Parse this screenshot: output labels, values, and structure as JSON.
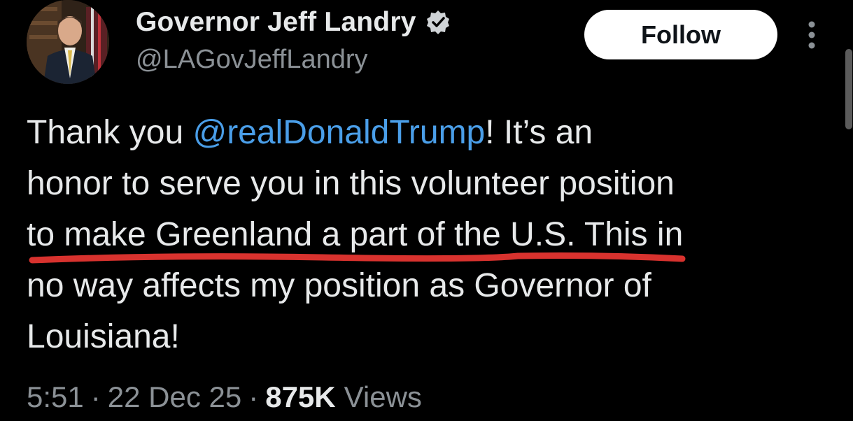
{
  "author": {
    "display_name": "Governor Jeff Landry",
    "handle": "@LAGovJeffLandry",
    "verified_icon": "verified-badge-icon",
    "avatar_icon": "profile-photo"
  },
  "actions": {
    "follow_label": "Follow",
    "more_icon": "more-vertical-icon"
  },
  "tweet": {
    "line1_pre": "Thank you ",
    "mention": "@realDonaldTrump",
    "line1_post": "! It’s an",
    "line2": "honor to serve you in this volunteer position",
    "line3": "to make Greenland a part of the U.S. This in",
    "line4": "no way affects my position as Governor of",
    "line5": "Louisiana!"
  },
  "meta": {
    "time": "5:51",
    "separator": "·",
    "date": "22 Dec 25",
    "view_count": "875K",
    "views_label": "Views"
  },
  "colors": {
    "background": "#000000",
    "text": "#e7e9ea",
    "secondary": "#8b9196",
    "mention": "#4a9ee8",
    "underline_annotation": "#d8322e",
    "follow_bg": "#ffffff"
  }
}
